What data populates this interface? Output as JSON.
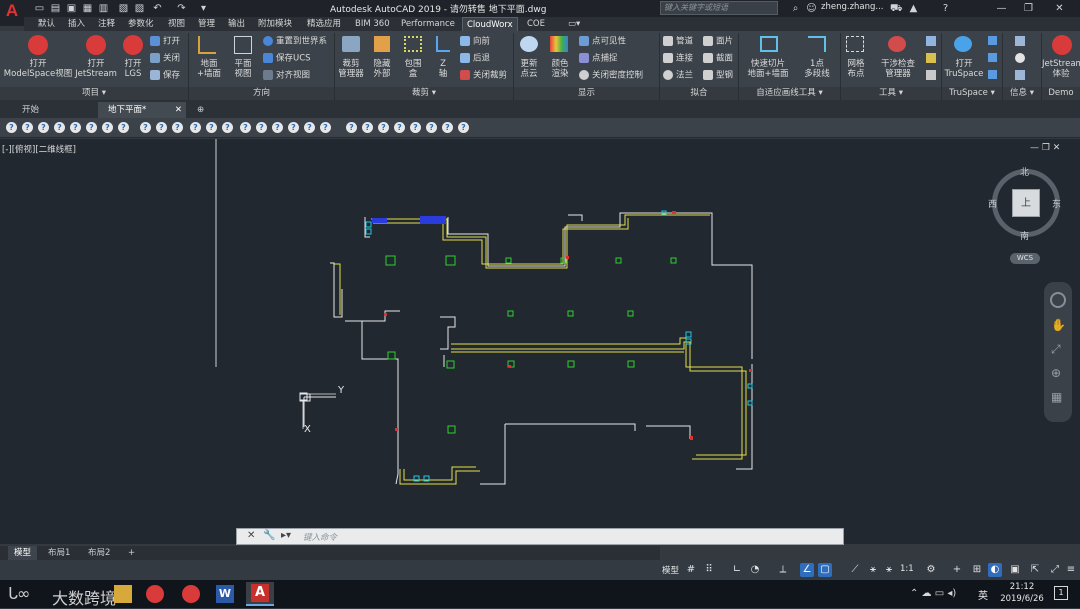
{
  "app": {
    "title": "Autodesk AutoCAD 2019 - 请勿转售    地下平面.dwg",
    "search_placeholder": "键入关键字或短语",
    "user": "zheng.zhang...",
    "logo_letter": "A"
  },
  "ribbon_tabs": [
    "默认",
    "插入",
    "注释",
    "参数化",
    "视图",
    "管理",
    "输出",
    "附加模块",
    "精选应用",
    "BIM 360",
    "Performance",
    "CloudWorx",
    "COE"
  ],
  "active_tab": "CloudWorx",
  "ribbon": {
    "project": {
      "title": "项目",
      "open_ms": "打开\nModelSpace视图",
      "open_js": "打开\nJetStream",
      "open_lgs": "打开\nLGS",
      "open": "打开",
      "close": "关闭",
      "save": "保存"
    },
    "direction": {
      "title": "方向",
      "ground_wall": "地面\n+墙面",
      "plan_view": "平面\n视图",
      "reset_world": "重置到世界系",
      "save_ucs": "保存UCS",
      "align_view": "对齐视图"
    },
    "clip": {
      "title": "裁剪",
      "clip_manager": "裁剪\n管理器",
      "hide_outside": "隐藏\n外部",
      "bounding_box": "包围\n盒",
      "z_axis": "Z\n轴",
      "forward": "向前",
      "backward": "后退",
      "close_clip": "关闭裁剪"
    },
    "display": {
      "title": "显示",
      "update_cloud": "更新\n点云",
      "color_render": "颜色\n渲染",
      "point_visible": "点可见性",
      "point_snap": "点捕捉",
      "close_density": "关闭密度控制"
    },
    "fit": {
      "title": "拟合",
      "pipe": "管道",
      "connect": "连接",
      "flange": "法兰",
      "surface": "面片",
      "section": "截面",
      "steel": "型钢"
    },
    "adaptive": {
      "title": "自适应画线工具",
      "fast_slice": "快速切片\n地面+墙面",
      "one_point": "1点\n多段线"
    },
    "tools": {
      "title": "工具",
      "mesh_points": "网格\n布点",
      "interference": "干涉检查\n管理器"
    },
    "truspace": {
      "title": "TruSpace",
      "open": "打开\nTruSpace"
    },
    "info": {
      "title": "信息"
    },
    "demo": {
      "title": "Demo",
      "jetstream": "JetStream\n体验"
    }
  },
  "doc_tabs": [
    "开始",
    "地下平面*"
  ],
  "viewport_label": "[-][俯视][二维线框]",
  "viewcube": {
    "north": "北",
    "south": "南",
    "east": "东",
    "west": "西",
    "top": "上",
    "wcs": "WCS"
  },
  "ucs": {
    "x": "X",
    "y": "Y"
  },
  "command": {
    "placeholder": "键入命令"
  },
  "layout_tabs": [
    "模型",
    "布局1",
    "布局2"
  ],
  "status": {
    "model": "模型",
    "scale": "1:1"
  },
  "taskbar": {
    "time": "21:12",
    "date": "2019/6/26",
    "lang": "英",
    "watermark": "大数跨境"
  },
  "colors": {
    "wall": "#e8e8e8",
    "yellow": "#e4e04a",
    "green": "#2fd12f",
    "cyan": "#1ec8e0",
    "blue": "#2a3cdc",
    "red": "#e03030",
    "accent": "#2f6dbd"
  }
}
